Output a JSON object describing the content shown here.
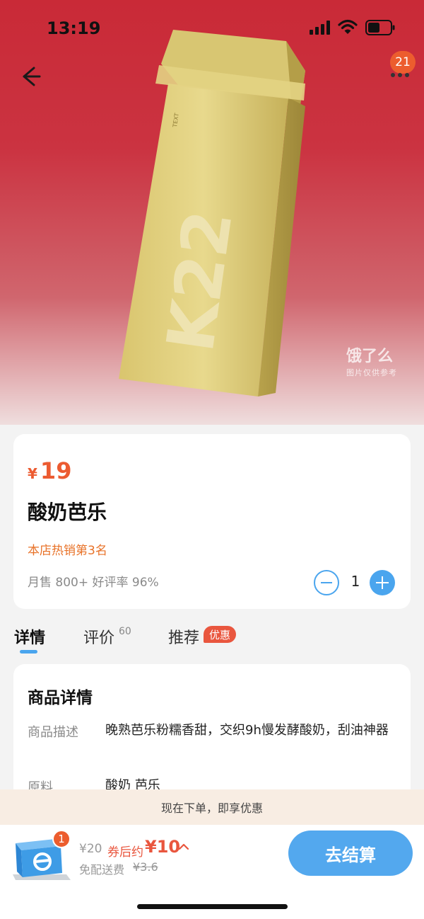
{
  "status_bar": {
    "time": "13:19"
  },
  "header": {
    "cart_count": "21"
  },
  "hero": {
    "watermark_logo": "饿了么",
    "watermark_note": "图片仅供参考"
  },
  "product": {
    "price_symbol": "¥",
    "price": "19",
    "name": "酸奶芭乐",
    "hot_rank": "本店热销第3名",
    "sales": "月售 800+ 好评率 96%",
    "quantity": "1"
  },
  "tabs": [
    {
      "label": "详情",
      "active": true
    },
    {
      "label": "评价",
      "count": "60"
    },
    {
      "label": "推荐",
      "badge": "优惠"
    }
  ],
  "details": {
    "title": "商品详情",
    "rows": [
      {
        "label": "商品描述",
        "value": "晚熟芭乐粉糯香甜，交织9h慢发酵酸奶，刮油神器"
      },
      {
        "label": "原料",
        "value": "酸奶 芭乐"
      }
    ]
  },
  "promo_strip": "现在下单，即享优惠",
  "checkout": {
    "cart_badge": "1",
    "original_total": "¥20",
    "coupon_label": "券后约",
    "coupon_price": "¥10",
    "delivery_free": "免配送费",
    "delivery_original": "¥3.6",
    "checkout_label": "去结算"
  },
  "colors": {
    "accent": "#4aa5ee",
    "price": "#ec5b31",
    "hero_top": "#c92a37"
  }
}
